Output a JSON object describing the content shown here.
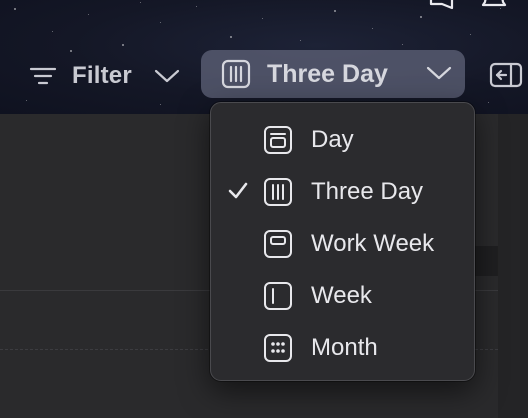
{
  "toolbar": {
    "filter_label": "Filter",
    "view_label": "Three Day"
  },
  "menu": {
    "items": [
      {
        "label": "Day",
        "icon": "day-view-icon",
        "selected": false
      },
      {
        "label": "Three Day",
        "icon": "three-day-view-icon",
        "selected": true
      },
      {
        "label": "Work Week",
        "icon": "work-week-view-icon",
        "selected": false
      },
      {
        "label": "Week",
        "icon": "week-view-icon",
        "selected": false
      },
      {
        "label": "Month",
        "icon": "month-view-icon",
        "selected": false
      }
    ]
  },
  "colors": {
    "toolbar_bg": "#141726",
    "view_button_bg": "#5c6076",
    "menu_bg": "#2b2b2e",
    "text": "#e8e8ec"
  }
}
